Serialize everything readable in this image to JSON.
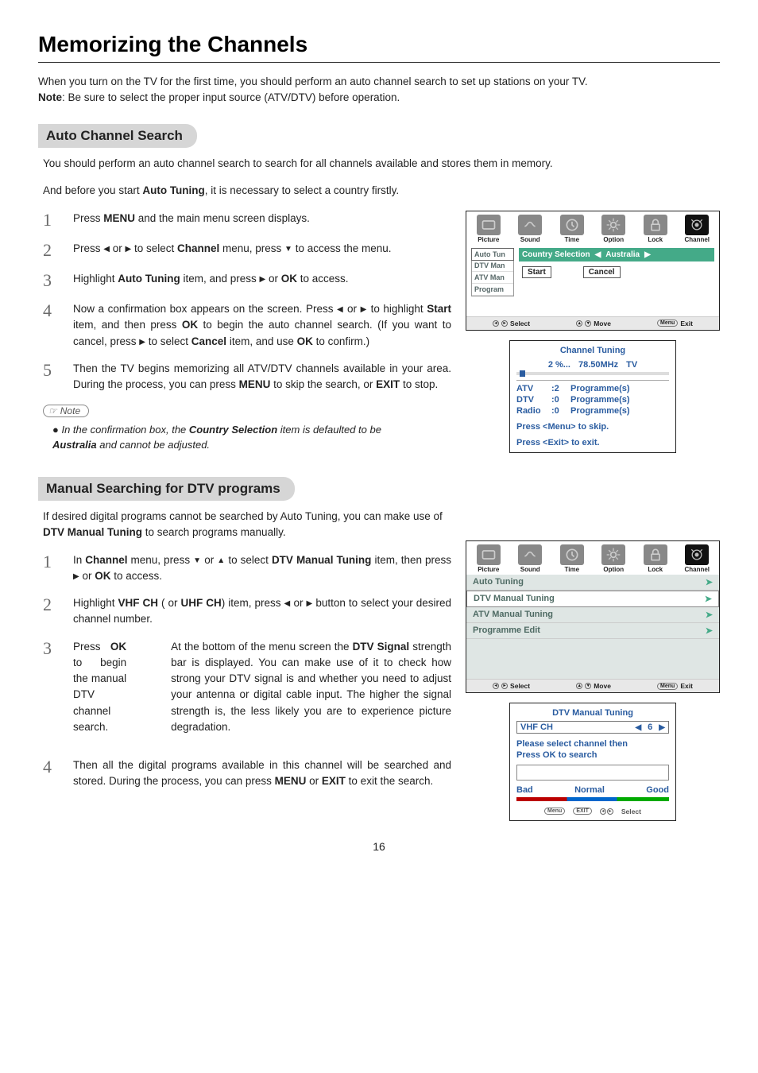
{
  "page_title": "Memorizing the Channels",
  "intro_line1": "When you turn on the TV for the first time, you should perform an auto channel search to set up stations on your TV.",
  "intro_note_label": "Note",
  "intro_note_text": ":  Be sure to select the proper input source (ATV/DTV) before operation.",
  "section1": {
    "title": "Auto Channel Search",
    "intro1": "You should perform an auto channel search to search for all channels available and stores them in memory.",
    "intro2_a": "And before you start ",
    "intro2_b": "Auto Tuning",
    "intro2_c": ", it is necessary to select a country firstly.",
    "steps": [
      {
        "n": "1",
        "text_parts": [
          "Press ",
          {
            "b": "MENU"
          },
          " and the main menu screen displays."
        ]
      },
      {
        "n": "2",
        "text_parts": [
          "Press ",
          {
            "tri": "◀"
          },
          " or ",
          {
            "tri": "▶"
          },
          " to select ",
          {
            "b": "Channel"
          },
          " menu,  press ",
          {
            "tri": "▼"
          },
          " to access the menu."
        ]
      },
      {
        "n": "3",
        "text_parts": [
          "Highlight ",
          {
            "b": "Auto Tuning"
          },
          " item, and press  ",
          {
            "tri": "▶"
          },
          " or ",
          {
            "b": "OK"
          },
          " to access."
        ]
      },
      {
        "n": "4",
        "text_parts": [
          "Now a confirmation box appears on the screen. Press ",
          {
            "tri": "◀"
          },
          " or ",
          {
            "tri": "▶"
          },
          " to highlight ",
          {
            "b": "Start"
          },
          " item, and then press ",
          {
            "b": "OK"
          },
          " to begin the auto channel search. (If you want to cancel, press ",
          {
            "tri": "▶"
          },
          " to select ",
          {
            "b": "Cancel"
          },
          " item, and use ",
          {
            "b": "OK"
          },
          "  to confirm.)"
        ]
      },
      {
        "n": "5",
        "text_parts": [
          "Then the TV begins memorizing all ATV/DTV channels available in your area. During the process, you can press ",
          {
            "b": "MENU"
          },
          " to skip the search, or ",
          {
            "b": "EXIT"
          },
          " to stop."
        ]
      }
    ],
    "note_label": "Note",
    "note_bullet": "●",
    "note_parts": [
      "In the confirmation box, the ",
      {
        "b": "Country Selection"
      },
      " item is defaulted to be ",
      {
        "b": "Australia"
      },
      " and cannot be adjusted."
    ]
  },
  "osd1": {
    "tabs": [
      "Picture",
      "Sound",
      "Time",
      "Option",
      "Lock",
      "Channel"
    ],
    "side": [
      "Auto Tun",
      "DTV Man",
      "ATV Man",
      "Program"
    ],
    "country_label": "Country Selection",
    "country_value": "Australia",
    "btn_start": "Start",
    "btn_cancel": "Cancel",
    "bar_select": "Select",
    "bar_move": "Move",
    "bar_menu": "Menu",
    "bar_exit": "Exit"
  },
  "tuning_popup": {
    "title": "Channel  Tuning",
    "percent": "2  %...",
    "freq": "78.50MHz",
    "band": "TV",
    "rows": [
      {
        "label": "ATV",
        "count": ":2",
        "unit": "Programme(s)"
      },
      {
        "label": "DTV",
        "count": ":0",
        "unit": "Programme(s)"
      },
      {
        "label": "Radio",
        "count": ":0",
        "unit": "Programme(s)"
      }
    ],
    "hint1": "Press <Menu> to skip.",
    "hint2": "Press <Exit> to exit."
  },
  "section2": {
    "title": "Manual Searching for DTV programs",
    "intro_a": "If desired digital programs cannot be searched by Auto Tuning, you can make use of ",
    "intro_b": "DTV Manual Tuning",
    "intro_c": " to search programs manually.",
    "steps": [
      {
        "n": "1",
        "text_parts": [
          "In ",
          {
            "b": "Channel"
          },
          " menu,  press ",
          {
            "tri": "▼"
          },
          " or ",
          {
            "tri": "▲"
          },
          " to select ",
          {
            "b": "DTV Manual Tuning"
          },
          " item, then press ",
          {
            "tri": "▶"
          },
          " or ",
          {
            "b": "OK"
          },
          " to access."
        ]
      },
      {
        "n": "2",
        "text_parts": [
          "Highlight ",
          {
            "b": "VHF CH"
          },
          " ( or ",
          {
            "b": "UHF CH"
          },
          ") item, press ",
          {
            "tri": "◀"
          },
          " or ",
          {
            "tri": "▶"
          },
          " button to select your desired channel number."
        ]
      },
      {
        "n": "3",
        "text_parts": [
          "Press ",
          {
            "b": "OK"
          },
          " to begin the manual DTV  channel search."
        ],
        "extra_parts": [
          "At the bottom of the menu screen the ",
          {
            "b": "DTV Signal"
          },
          " strength bar is displayed. You can make use of it to check how strong your DTV signal is and whether you need to adjust your antenna or digital cable input. The higher the signal strength is, the less likely you are to experience picture degradation."
        ]
      },
      {
        "n": "4",
        "text_parts": [
          "Then all the digital programs available in this channel will be searched and stored. During the process, you can press ",
          {
            "b": "MENU"
          },
          " or ",
          {
            "b": "EXIT"
          },
          " to exit the search."
        ]
      }
    ]
  },
  "osd2": {
    "tabs": [
      "Picture",
      "Sound",
      "Time",
      "Option",
      "Lock",
      "Channel"
    ],
    "rows": [
      "Auto Tuning",
      "DTV Manual Tuning",
      "ATV Manual Tuning",
      "Programme Edit"
    ],
    "bar_select": "Select",
    "bar_move": "Move",
    "bar_menu": "Menu",
    "bar_exit": "Exit"
  },
  "dtv_popup": {
    "title": "DTV Manual Tuning",
    "vhf_label": "VHF  CH",
    "vhf_value": "6",
    "msg1": "Please select channel then",
    "msg2": "Press OK to search",
    "q_bad": "Bad",
    "q_norm": "Normal",
    "q_good": "Good",
    "foot_menu": "Menu",
    "foot_exit": "EXIT",
    "foot_select": "Select"
  },
  "page_number": "16"
}
